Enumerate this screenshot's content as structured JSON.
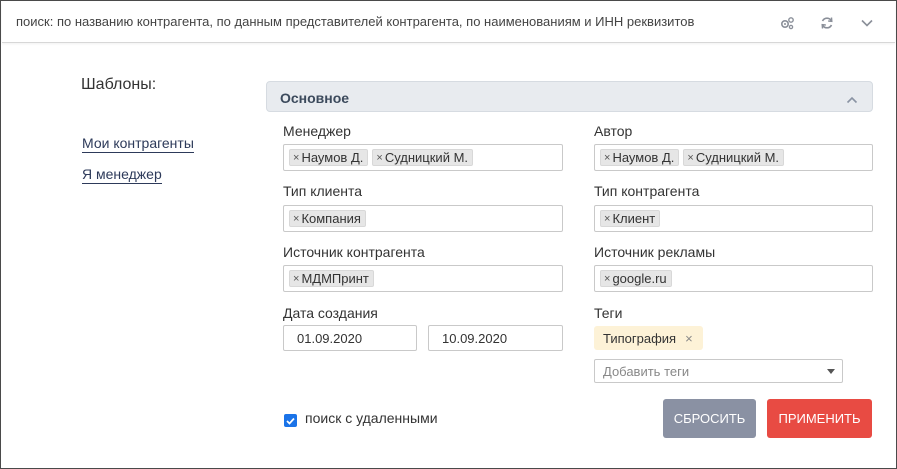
{
  "search": {
    "placeholder": "поиск: по названию контрагента, по данным представителей контрагента, по наименованиям и ИНН реквизитов"
  },
  "templates": {
    "title": "Шаблоны:",
    "items": [
      {
        "label": "Мои контрагенты"
      },
      {
        "label": "Я менеджер"
      }
    ]
  },
  "section": {
    "title": "Основное"
  },
  "fields": {
    "manager": {
      "label": "Менеджер",
      "tags": [
        "Наумов Д.",
        "Судницкий М."
      ]
    },
    "author": {
      "label": "Автор",
      "tags": [
        "Наумов Д.",
        "Судницкий М."
      ]
    },
    "client_type": {
      "label": "Тип клиента",
      "tags": [
        "Компания"
      ]
    },
    "contractor_type": {
      "label": "Тип контрагента",
      "tags": [
        "Клиент"
      ]
    },
    "source": {
      "label": "Источник контрагента",
      "tags": [
        "МДМПринт"
      ]
    },
    "ad_source": {
      "label": "Источник рекламы",
      "tags": [
        "google.ru"
      ]
    },
    "created": {
      "label": "Дата создания",
      "from": "01.09.2020",
      "to": "10.09.2020"
    },
    "tags": {
      "label": "Теги",
      "chips": [
        "Типография"
      ],
      "add_placeholder": "Добавить теги"
    }
  },
  "options": {
    "with_deleted_label": "поиск с удаленными",
    "with_deleted_checked": true
  },
  "buttons": {
    "reset": "СБРОСИТЬ",
    "apply": "ПРИМЕНИТЬ"
  },
  "icons": {
    "remove": "×"
  }
}
